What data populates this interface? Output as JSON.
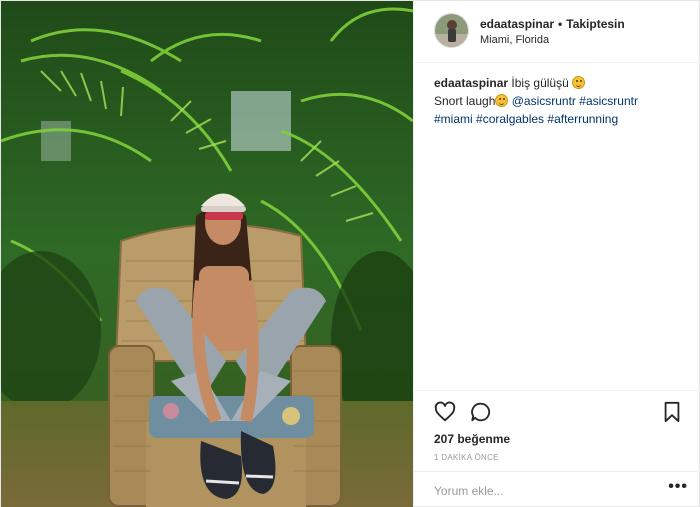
{
  "post": {
    "username": "edaataspinar",
    "separator": "•",
    "follow_status": "Takiptesin",
    "location": "Miami, Florida"
  },
  "caption": {
    "username": "edaataspinar",
    "text_line1": "İbiş gülüşü",
    "text_line2": "Snort laugh",
    "mention": "@asicsruntr",
    "hashtags": [
      "#asicsruntr",
      "#miami",
      "#coralgables",
      "#afterrunning"
    ]
  },
  "actions": {
    "like_icon": "heart-icon",
    "comment_icon": "comment-icon",
    "save_icon": "bookmark-icon"
  },
  "likes_label": "207 beğenme",
  "timestamp": "1 DAKİKA ÖNCE",
  "comment": {
    "placeholder": "Yorum ekle...",
    "more_label": "•••"
  },
  "colors": {
    "hashtag": "#003569",
    "border": "#efefef",
    "muted": "#999999"
  }
}
